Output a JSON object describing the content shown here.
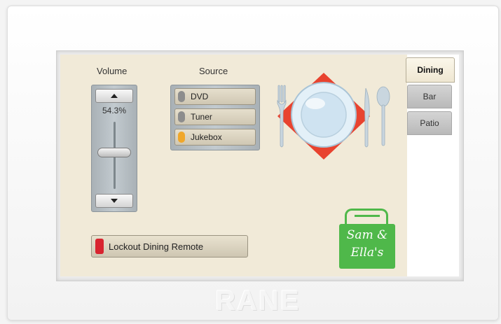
{
  "volume": {
    "label": "Volume",
    "readout": "54.3%",
    "level": 0.543
  },
  "source": {
    "label": "Source",
    "options": [
      {
        "label": "DVD",
        "selected": false
      },
      {
        "label": "Tuner",
        "selected": false
      },
      {
        "label": "Jukebox",
        "selected": true
      }
    ]
  },
  "lockout": {
    "label": "Lockout Dining Remote"
  },
  "tabs": [
    {
      "label": "Dining",
      "active": true
    },
    {
      "label": "Bar",
      "active": false
    },
    {
      "label": "Patio",
      "active": false
    }
  ],
  "logo": {
    "line1": "Sam &",
    "line2": "Ella's"
  },
  "brand": "RANE",
  "colors": {
    "panel_bg": "#f1ead8",
    "lamp_active": "#f0a72a",
    "lockout_lamp": "#d8242f",
    "logo_green": "#4fb84a",
    "plate_red": "#e8432f"
  },
  "icons": [
    "plate-setting-icon",
    "arrow-up-icon",
    "arrow-down-icon"
  ]
}
